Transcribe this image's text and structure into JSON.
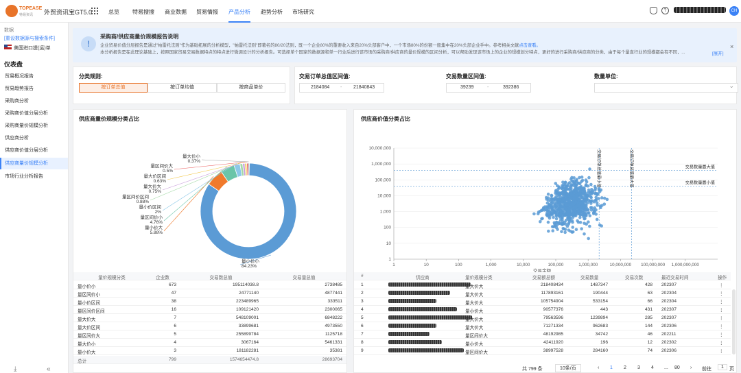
{
  "header": {
    "logo_brand": "TOPEASE",
    "logo_sub": "特易资讯",
    "app_title": "外贸资讯宝GT5.0",
    "nav": [
      "总览",
      "特易搜搜",
      "商业数据",
      "贸易情报",
      "产品分析",
      "趋势分析",
      "市场研究"
    ],
    "active_nav": "产品分析",
    "avatar_initials": "CH"
  },
  "sidebar": {
    "data_label": "数据",
    "reselect_link": "[重设数据源与搜索条件]",
    "country": "美国进口提(运)单",
    "dashboard_heading": "仪表盘",
    "items": [
      "贸易概况报告",
      "贸易趋势报告",
      "采购商分析",
      "采购商价值分层分析",
      "采购商量价规模分析",
      "供应商分析",
      "供应商价值分层分析",
      "供应商量价规模分析",
      "市场行业分析报告"
    ],
    "active_item": "供应商量价规模分析"
  },
  "banner": {
    "title": "采购商/供应商量价规模报告说明",
    "line1": "企业贸易价值分层报告是通过\"帕雷托法则\"作为基础拓展的分析模型，\"帕雷托法则\"即著名的80/20法则，既一个企业80%的重要收入来自20%头部客户中，一个市场80%的份额一般集中在20%头部企业手中。参考相关文献",
    "line1_link": "点击查看。",
    "line2": "本分析报告是在此理论基础上，按照国家贸易交易数据特点的特点进行微调设计的分析报告。可选择单个国家的数据源和单一行业后进行该市场的采购商/供应商的量价规模的区间分析，可以帮助发现该市场上的企业的规模划分特点，更好的进行采购商/供应商的分类，由于每个量直行业的规模都会有不同，...",
    "expand": "[展开]"
  },
  "filters": {
    "classify_label": "分类规则:",
    "classify_options": [
      "按订单总值",
      "按订单均值",
      "按商品单价"
    ],
    "active_option": "按订单总值",
    "order_range_label": "交易订单总值区间值:",
    "order_min": "2184084",
    "order_max": "21840843",
    "qty_range_label": "交易数量区间值:",
    "qty_min": "39239",
    "qty_max": "392386",
    "unit_label": "数量单位:",
    "range_sep": "-"
  },
  "donut_panel": {
    "title": "供应商量价规模分类占比",
    "slices": [
      {
        "label": "量小价小",
        "pct": 84.23,
        "pct_text": "84.23%",
        "color": "#5b9bd5"
      },
      {
        "label": "量小价大",
        "pct": 5.88,
        "pct_text": "5.88%",
        "color": "#f07a2c"
      },
      {
        "label": "量区间价小",
        "pct": 4.76,
        "pct_text": "4.76%",
        "color": "#6ac5a8"
      },
      {
        "label": "量小价区间",
        "pct": 2,
        "pct_text": "2%",
        "color": "#8cc8e8"
      },
      {
        "label": "量区间价区间",
        "pct": 0.88,
        "pct_text": "0.88%",
        "color": "#a3d9a5"
      },
      {
        "label": "量大价大",
        "pct": 0.75,
        "pct_text": "0.75%",
        "color": "#c9a0dc"
      },
      {
        "label": "量大价区间",
        "pct": 0.63,
        "pct_text": "0.63%",
        "color": "#f2c94c"
      },
      {
        "label": "量区间价大",
        "pct": 0.5,
        "pct_text": "0.5%",
        "color": "#eb5757"
      },
      {
        "label": "量大价小",
        "pct": 0.37,
        "pct_text": "0.37%",
        "color": "#9b9b9b"
      }
    ],
    "table_headers": [
      "量价规模分类",
      "企业数",
      "交易数总值",
      "交易量总值"
    ],
    "rows": [
      [
        "量小价小",
        "673",
        "195114038.8",
        "2738485"
      ],
      [
        "量区间价小",
        "47",
        "24771140",
        "4877441"
      ],
      [
        "量小价区间",
        "38",
        "223489965",
        "333511"
      ],
      [
        "量区间价区间",
        "16",
        "109121420",
        "2300065"
      ],
      [
        "量大价大",
        "7",
        "548109001",
        "6848222"
      ],
      [
        "量大价区间",
        "6",
        "33899681",
        "4973550"
      ],
      [
        "量区间价大",
        "5",
        "255899784",
        "1125718"
      ],
      [
        "量大价小",
        "4",
        "3067164",
        "5461331"
      ],
      [
        "量小价大",
        "3",
        "181182281",
        "35381"
      ]
    ],
    "total_row": [
      "总计",
      "799",
      "1574654474.8",
      "28693704"
    ]
  },
  "scatter_panel": {
    "title": "供应商价值分类占比",
    "chart_data": {
      "type": "scatter",
      "title": "供应商价值分类占比",
      "xlabel": "交易金额",
      "ylabel": "",
      "xscale": "log",
      "yscale": "log",
      "xlim": [
        1,
        10000000000
      ],
      "ylim": [
        1,
        10000000
      ],
      "x_ticks": [
        "1",
        "10",
        "100",
        "1,000",
        "10,000",
        "100,000",
        "1,000,000",
        "10,000,000",
        "100,000,000",
        "1,000,000,000"
      ],
      "y_ticks": [
        "1",
        "10",
        "100",
        "1,000",
        "10,000",
        "100,000",
        "1,000,000",
        "10,000,000"
      ],
      "point_count": 799,
      "cluster": {
        "x_range": [
          10000,
          100000000
        ],
        "y_range": [
          1,
          2000000
        ],
        "center_x": 300000,
        "center_y": 3000
      },
      "ref_lines": [
        {
          "label": "交易订单总值最小值",
          "axis": "x",
          "value": 2184084
        },
        {
          "label": "交易订单总值最大值",
          "axis": "x",
          "value": 21840843
        },
        {
          "label": "交易数量最大值",
          "axis": "y",
          "value": 392386
        },
        {
          "label": "交易数量最小值",
          "axis": "y",
          "value": 39239
        }
      ],
      "color": "#5b9bd5"
    },
    "table_headers": [
      "#",
      "供应商",
      "量价规模分类",
      "交易额总额",
      "交易数量",
      "交易次数",
      "最近交易时间",
      "操作"
    ],
    "rows": [
      [
        "1",
        "",
        "量大价大",
        "218408434",
        "1487347",
        "428",
        "202307"
      ],
      [
        "2",
        "",
        "量大价大",
        "117893161",
        "190444",
        "63",
        "202304"
      ],
      [
        "3",
        "",
        "量大价大",
        "10575490​4",
        "533154",
        "66",
        "202304"
      ],
      [
        "4",
        "",
        "量小价大",
        "90577376",
        "443",
        "431",
        "202307"
      ],
      [
        "5",
        "",
        "量大价大",
        "79563596",
        "1239894",
        "285",
        "202307"
      ],
      [
        "6",
        "",
        "量大价大",
        "71271334",
        "962683",
        "144",
        "202306"
      ],
      [
        "7",
        "",
        "量区间价大",
        "48192985",
        "34742",
        "46",
        "202211"
      ],
      [
        "8",
        "",
        "量小价大",
        "42411920",
        "196",
        "12",
        "202302"
      ],
      [
        "9",
        "",
        "量区间价大",
        "38997528",
        "284160",
        "74",
        "202306"
      ]
    ],
    "pager": {
      "total": "共 799 条",
      "page_size": "10条/页",
      "pages": [
        "1",
        "2",
        "3",
        "4",
        "...",
        "80"
      ],
      "goto_label": "前往",
      "goto_value": "1",
      "page_suffix": "页",
      "prev": "‹",
      "next": "›"
    }
  }
}
